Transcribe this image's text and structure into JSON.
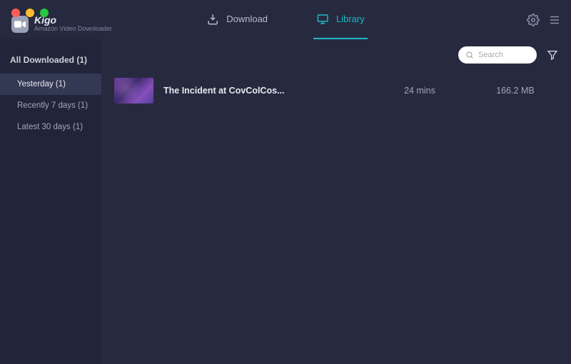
{
  "brand": {
    "name": "Kigo",
    "subtitle": "Amazon Video Downloader"
  },
  "tabs": {
    "download": "Download",
    "library": "Library"
  },
  "search": {
    "placeholder": "Search"
  },
  "sidebar": {
    "header": "All Downloaded (1)",
    "items": [
      {
        "label": "Yesterday (1)"
      },
      {
        "label": "Recently 7 days (1)"
      },
      {
        "label": "Latest 30 days (1)"
      }
    ]
  },
  "rows": [
    {
      "title": "The Incident at CovColCos...",
      "duration": "24 mins",
      "size": "166.2 MB"
    }
  ]
}
